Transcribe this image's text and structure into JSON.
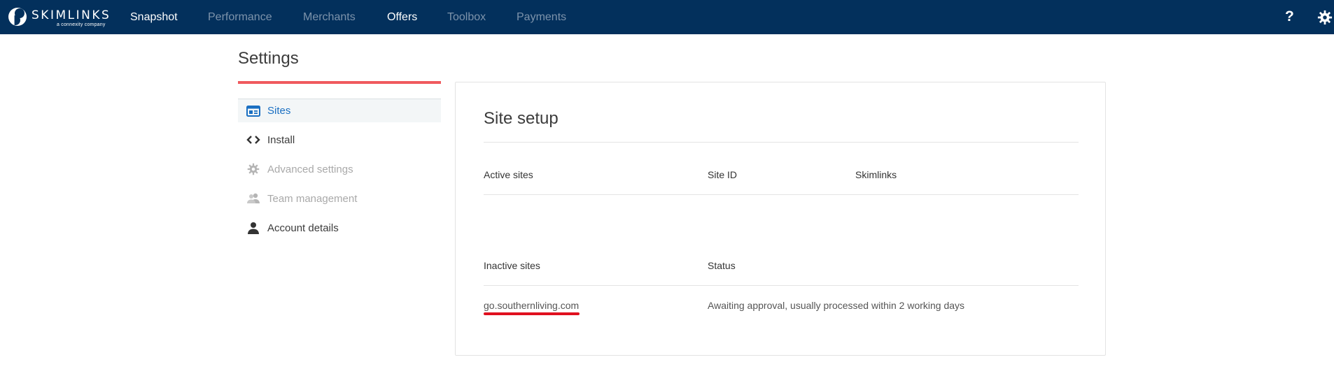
{
  "brand": {
    "name": "SKIMLINKS",
    "tagline": "a connexity company"
  },
  "nav": {
    "items": [
      {
        "label": "Snapshot",
        "active": true
      },
      {
        "label": "Performance",
        "active": false
      },
      {
        "label": "Merchants",
        "active": false
      },
      {
        "label": "Offers",
        "active": true
      },
      {
        "label": "Toolbox",
        "active": false
      },
      {
        "label": "Payments",
        "active": false
      }
    ],
    "help_label": "?",
    "settings_icon": "gear-icon"
  },
  "page": {
    "title": "Settings"
  },
  "sidebar": {
    "items": [
      {
        "label": "Sites",
        "icon": "browser-window-icon",
        "state": "active"
      },
      {
        "label": "Install",
        "icon": "code-brackets-icon",
        "state": "normal"
      },
      {
        "label": "Advanced settings",
        "icon": "gear-icon",
        "state": "disabled"
      },
      {
        "label": "Team management",
        "icon": "users-icon",
        "state": "disabled"
      },
      {
        "label": "Account details",
        "icon": "person-icon",
        "state": "normal"
      }
    ]
  },
  "site_setup": {
    "title": "Site setup",
    "active_table": {
      "headers": [
        "Active sites",
        "Site ID",
        "Skimlinks"
      ],
      "rows": []
    },
    "inactive_table": {
      "headers": [
        "Inactive sites",
        "Status"
      ],
      "rows": [
        {
          "site": "go.southernliving.com",
          "status": "Awaiting approval, usually processed within 2 working days"
        }
      ]
    }
  },
  "colors": {
    "topbar": "#03305c",
    "accent_red": "#f05a5e",
    "active_link": "#1a6fc2",
    "annotation_red": "#e0101f"
  }
}
